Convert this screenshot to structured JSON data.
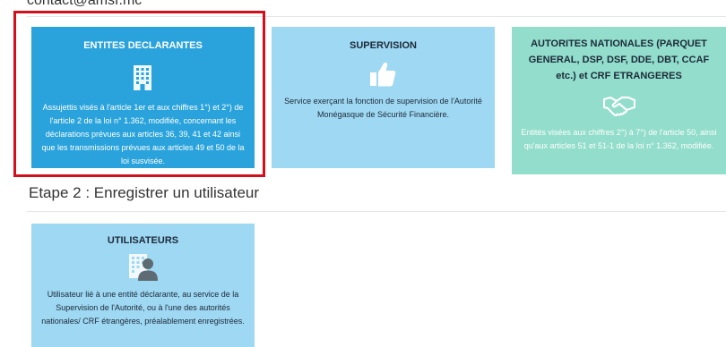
{
  "contact": {
    "email": "contact@amsf.mc"
  },
  "cards": [
    {
      "title": "ENTITES DECLARANTES",
      "description": "Assujettis visés à l'article 1er et aux chiffres 1°) et 2°) de l'article 2 de la loi n° 1.362, modifiée, concernant les déclarations prévues aux articles 36, 39, 41 et 42 ainsi que les transmissions prévues aux articles 49 et 50 de la loi susvisée.",
      "icon": "building-icon",
      "color": "#2aa3dc"
    },
    {
      "title": "SUPERVISION",
      "description": "Service exerçant la fonction de supervision de l'Autorité Monégasque de Sécurité Financière.",
      "icon": "thumbs-up-icon",
      "color": "#9fd8f2"
    },
    {
      "title": "AUTORITES NATIONALES (PARQUET GENERAL, DSP, DSF, DDE, DBT, CCAF etc.) et CRF ETRANGERES",
      "description": "Entités visées aux chiffres 2°) à 7°) de l'article 50, ainsi qu'aux articles 51 et 51-1 de la loi n° 1.362, modifiée.",
      "icon": "handshake-icon",
      "color": "#92ddcb"
    }
  ],
  "step2": {
    "title": "Etape 2 : Enregistrer un utilisateur",
    "card": {
      "title": "UTILISATEURS",
      "description": "Utilisateur lié à une entité déclarante, au service de la Supervision de l'Autorité, ou à l'une des autorités nationales/ CRF étrangères, préalablement enregistrées.",
      "icon": "user-building-icon",
      "color": "#9fd8f2"
    }
  },
  "highlight_color": "#d0111b"
}
